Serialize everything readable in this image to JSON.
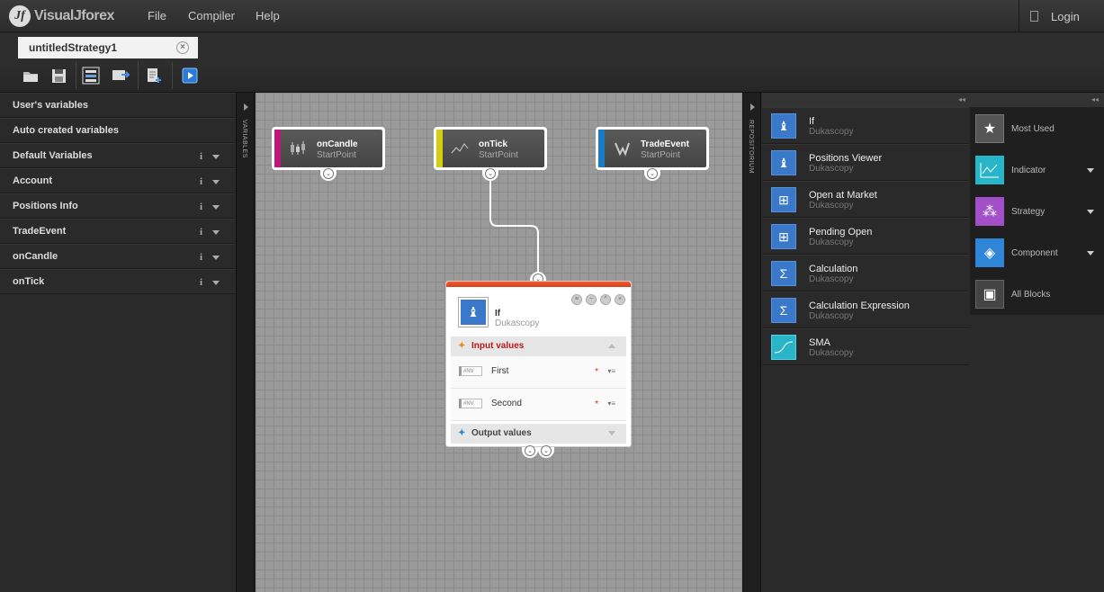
{
  "app": {
    "logo_mark": "Jf",
    "logo_text": "VisualJforex"
  },
  "menu": {
    "file": "File",
    "compiler": "Compiler",
    "help": "Help",
    "login": "Login"
  },
  "tab": {
    "title": "untitledStrategy1",
    "close": "×"
  },
  "left_panel": {
    "items": [
      {
        "label": "User's variables"
      },
      {
        "label": "Auto created variables"
      },
      {
        "label": "Default Variables",
        "info": "i"
      },
      {
        "label": "Account",
        "info": "i"
      },
      {
        "label": "Positions Info",
        "info": "i"
      },
      {
        "label": "TradeEvent",
        "info": "i"
      },
      {
        "label": "onCandle",
        "info": "i"
      },
      {
        "label": "onTick",
        "info": "i"
      }
    ]
  },
  "strips": {
    "variables": "VARIABLES",
    "repository": "REPOSITORIUM"
  },
  "canvas": {
    "startpoints": [
      {
        "title": "onCandle",
        "subtitle": "StartPoint",
        "color": "#c0187a"
      },
      {
        "title": "onTick",
        "subtitle": "StartPoint",
        "color": "#d6cc10"
      },
      {
        "title": "TradeEvent",
        "subtitle": "StartPoint",
        "color": "#1a7cc8"
      }
    ],
    "if_block": {
      "title": "If",
      "subtitle": "Dukascopy",
      "input_section": "Input values",
      "inputs": [
        {
          "tag": "#NV",
          "label": "First",
          "required": "*"
        },
        {
          "tag": "#NV",
          "label": "Second",
          "required": "*"
        }
      ],
      "output_section": "Output values"
    }
  },
  "repository": {
    "items": [
      {
        "title": "If",
        "subtitle": "Dukascopy",
        "icon": "if-icon"
      },
      {
        "title": "Positions Viewer",
        "subtitle": "Dukascopy",
        "icon": "if-icon"
      },
      {
        "title": "Open at Market",
        "subtitle": "Dukascopy",
        "icon": "basket-icon"
      },
      {
        "title": "Pending Open",
        "subtitle": "Dukascopy",
        "icon": "basket-icon"
      },
      {
        "title": "Calculation",
        "subtitle": "Dukascopy",
        "icon": "sigma-icon"
      },
      {
        "title": "Calculation Expression",
        "subtitle": "Dukascopy",
        "icon": "sigma-icon"
      },
      {
        "title": "SMA",
        "subtitle": "Dukascopy",
        "icon": "sma-icon"
      }
    ]
  },
  "categories": {
    "items": [
      {
        "label": "Most Used",
        "color": "#555555",
        "icon": "star-icon"
      },
      {
        "label": "Indicator",
        "color": "#29b5c8",
        "icon": "indicator-icon"
      },
      {
        "label": "Strategy",
        "color": "#a24fc8",
        "icon": "strategy-icon"
      },
      {
        "label": "Component",
        "color": "#2f86d8",
        "icon": "component-icon"
      },
      {
        "label": "All Blocks",
        "color": "#444444",
        "icon": "blocks-icon"
      }
    ]
  }
}
